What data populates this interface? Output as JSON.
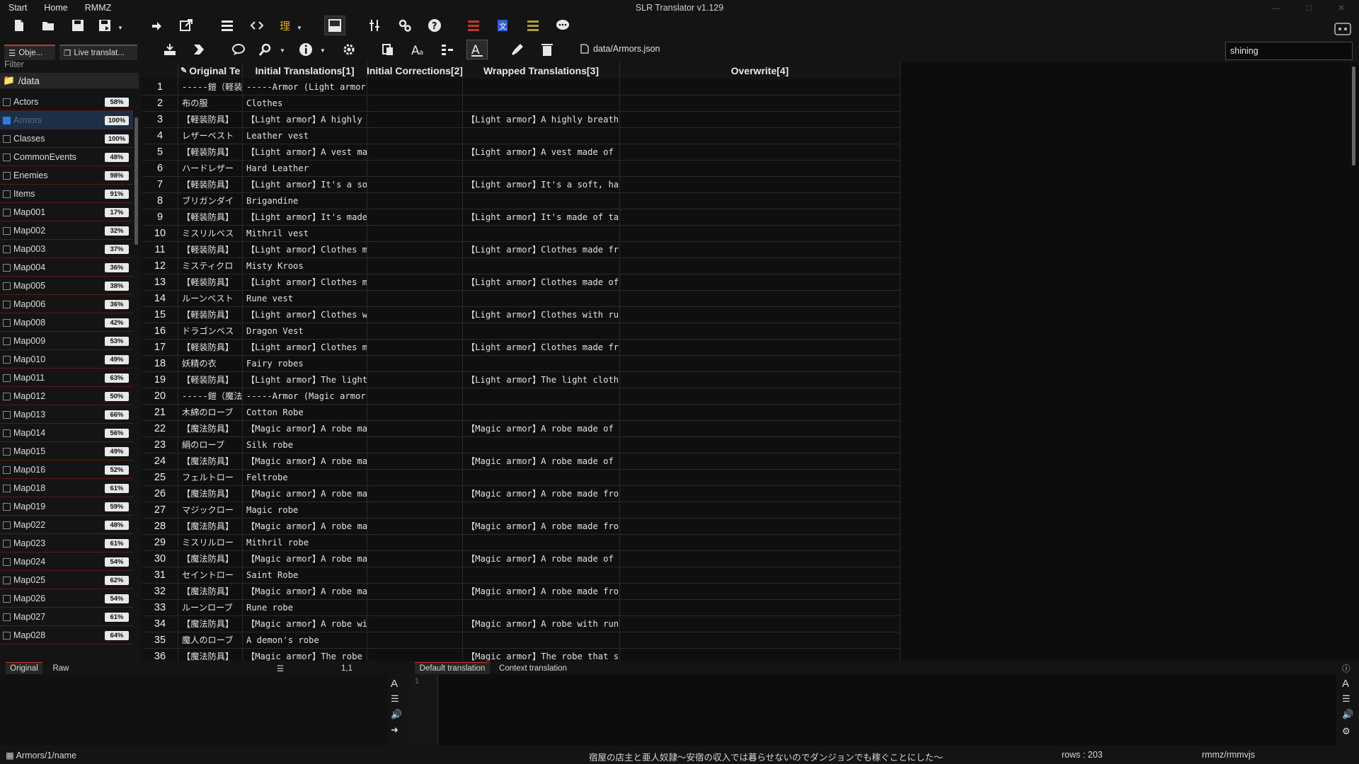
{
  "window": {
    "title": "SLR Translator v1.129"
  },
  "menu": [
    "Start",
    "Home",
    "RMMZ"
  ],
  "toolbar": {
    "file_path": "data/Armors.json",
    "search_value": "shining"
  },
  "sidebar": {
    "tabs": [
      "Obje...",
      "Live translat..."
    ],
    "filter_label": "Filter",
    "folder": "/data",
    "files": [
      {
        "name": "Actors",
        "pct": "58%"
      },
      {
        "name": "Armors",
        "pct": "100%",
        "selected": true
      },
      {
        "name": "Classes",
        "pct": "100%"
      },
      {
        "name": "CommonEvents",
        "pct": "48%"
      },
      {
        "name": "Enemies",
        "pct": "98%"
      },
      {
        "name": "Items",
        "pct": "91%"
      },
      {
        "name": "Map001",
        "pct": "17%"
      },
      {
        "name": "Map002",
        "pct": "32%"
      },
      {
        "name": "Map003",
        "pct": "37%"
      },
      {
        "name": "Map004",
        "pct": "36%"
      },
      {
        "name": "Map005",
        "pct": "38%"
      },
      {
        "name": "Map006",
        "pct": "36%"
      },
      {
        "name": "Map008",
        "pct": "42%"
      },
      {
        "name": "Map009",
        "pct": "53%"
      },
      {
        "name": "Map010",
        "pct": "49%"
      },
      {
        "name": "Map011",
        "pct": "63%"
      },
      {
        "name": "Map012",
        "pct": "50%"
      },
      {
        "name": "Map013",
        "pct": "66%"
      },
      {
        "name": "Map014",
        "pct": "56%"
      },
      {
        "name": "Map015",
        "pct": "49%"
      },
      {
        "name": "Map016",
        "pct": "52%"
      },
      {
        "name": "Map018",
        "pct": "61%"
      },
      {
        "name": "Map019",
        "pct": "59%"
      },
      {
        "name": "Map022",
        "pct": "48%"
      },
      {
        "name": "Map023",
        "pct": "61%"
      },
      {
        "name": "Map024",
        "pct": "54%"
      },
      {
        "name": "Map025",
        "pct": "62%"
      },
      {
        "name": "Map026",
        "pct": "54%"
      },
      {
        "name": "Map027",
        "pct": "61%"
      },
      {
        "name": "Map028",
        "pct": "64%"
      }
    ]
  },
  "grid": {
    "columns": [
      "Original Te",
      "Initial Translations[1]",
      "Initial Corrections[2]",
      "Wrapped Translations[3]",
      "Overwrite[4]"
    ],
    "rows": [
      [
        "1",
        "-----鎧（軽装",
        "-----Armor (Light armor)",
        "",
        "",
        ""
      ],
      [
        "2",
        "布の服",
        "Clothes",
        "",
        "",
        ""
      ],
      [
        "3",
        "【軽装防具】",
        "【Light armor】A highly",
        "",
        "【Light armor】A highly breath",
        ""
      ],
      [
        "4",
        "レザーベスト",
        "Leather vest",
        "",
        "",
        ""
      ],
      [
        "5",
        "【軽装防具】",
        "【Light armor】A vest ma",
        "",
        "【Light armor】A vest made of",
        ""
      ],
      [
        "6",
        "ハードレザー",
        "Hard Leather",
        "",
        "",
        ""
      ],
      [
        "7",
        "【軽装防具】",
        "【Light armor】It's a so",
        "",
        "【Light armor】It's a soft, ha",
        ""
      ],
      [
        "8",
        "ブリガンダイ",
        "Brigandine",
        "",
        "",
        ""
      ],
      [
        "9",
        "【軽装防具】",
        "【Light armor】It's made",
        "",
        "【Light armor】It's made of ta",
        ""
      ],
      [
        "10",
        "ミスリルベス",
        "Mithril vest",
        "",
        "",
        ""
      ],
      [
        "11",
        "【軽装防具】",
        "【Light armor】Clothes m",
        "",
        "【Light armor】Clothes made fr",
        ""
      ],
      [
        "12",
        "ミスティクロ",
        "Misty Kroos",
        "",
        "",
        ""
      ],
      [
        "13",
        "【軽装防具】",
        "【Light armor】Clothes m",
        "",
        "【Light armor】Clothes made of",
        ""
      ],
      [
        "14",
        "ルーンベスト",
        "Rune vest",
        "",
        "",
        ""
      ],
      [
        "15",
        "【軽装防具】",
        "【Light armor】Clothes w",
        "",
        "【Light armor】Clothes with ru",
        ""
      ],
      [
        "16",
        "ドラゴンベス",
        "Dragon Vest",
        "",
        "",
        ""
      ],
      [
        "17",
        "【軽装防具】",
        "【Light armor】Clothes m",
        "",
        "【Light armor】Clothes made fr",
        ""
      ],
      [
        "18",
        "妖精の衣",
        "Fairy robes",
        "",
        "",
        ""
      ],
      [
        "19",
        "【軽装防具】",
        "【Light armor】The light",
        "",
        "【Light armor】The light cloth",
        ""
      ],
      [
        "20",
        "-----鎧（魔法",
        "-----Armor (Magic armor)",
        "",
        "",
        ""
      ],
      [
        "21",
        "木綿のローブ",
        "Cotton Robe",
        "",
        "",
        ""
      ],
      [
        "22",
        "【魔法防具】",
        "【Magic armor】A robe ma",
        "",
        "【Magic armor】A robe made of",
        ""
      ],
      [
        "23",
        "絹のローブ",
        "Silk robe",
        "",
        "",
        ""
      ],
      [
        "24",
        "【魔法防具】",
        "【Magic armor】A robe ma",
        "",
        "【Magic armor】A robe made of",
        ""
      ],
      [
        "25",
        "フェルトロー",
        "Feltrobe",
        "",
        "",
        ""
      ],
      [
        "26",
        "【魔法防具】",
        "【Magic armor】A robe ma",
        "",
        "【Magic armor】A robe made fro",
        ""
      ],
      [
        "27",
        "マジックロー",
        "Magic robe",
        "",
        "",
        ""
      ],
      [
        "28",
        "【魔法防具】",
        "【Magic armor】A robe ma",
        "",
        "【Magic armor】A robe made fro",
        ""
      ],
      [
        "29",
        "ミスリルロー",
        "Mithril robe",
        "",
        "",
        ""
      ],
      [
        "30",
        "【魔法防具】",
        "【Magic armor】A robe ma",
        "",
        "【Magic armor】A robe made of",
        ""
      ],
      [
        "31",
        "セイントロー",
        "Saint Robe",
        "",
        "",
        ""
      ],
      [
        "32",
        "【魔法防具】",
        "【Magic armor】A robe ma",
        "",
        "【Magic armor】A robe made fro",
        ""
      ],
      [
        "33",
        "ルーンローブ",
        "Rune robe",
        "",
        "",
        ""
      ],
      [
        "34",
        "【魔法防具】",
        "【Magic armor】A robe wi",
        "",
        "【Magic armor】A robe with run",
        ""
      ],
      [
        "35",
        "魔人のローブ",
        "A demon's robe",
        "",
        "",
        ""
      ],
      [
        "36",
        "【魔法防具】",
        "【Magic armor】The robe",
        "",
        "【Magic armor】The robe that s",
        ""
      ]
    ]
  },
  "bottom": {
    "left_tabs": [
      "Original",
      "Raw"
    ],
    "cell_position": "1,1",
    "right_tabs": [
      "Default translation",
      "Context translation"
    ],
    "line_number": "1"
  },
  "status": {
    "path": "Armors/1/name",
    "game_title": "宿屋の店主と亜人奴隷～安宿の収入では暮らせないのでダンジョンでも稼ぐことにした～",
    "rows": "rows : 203",
    "engine": "rmmz/rmmvjs"
  }
}
